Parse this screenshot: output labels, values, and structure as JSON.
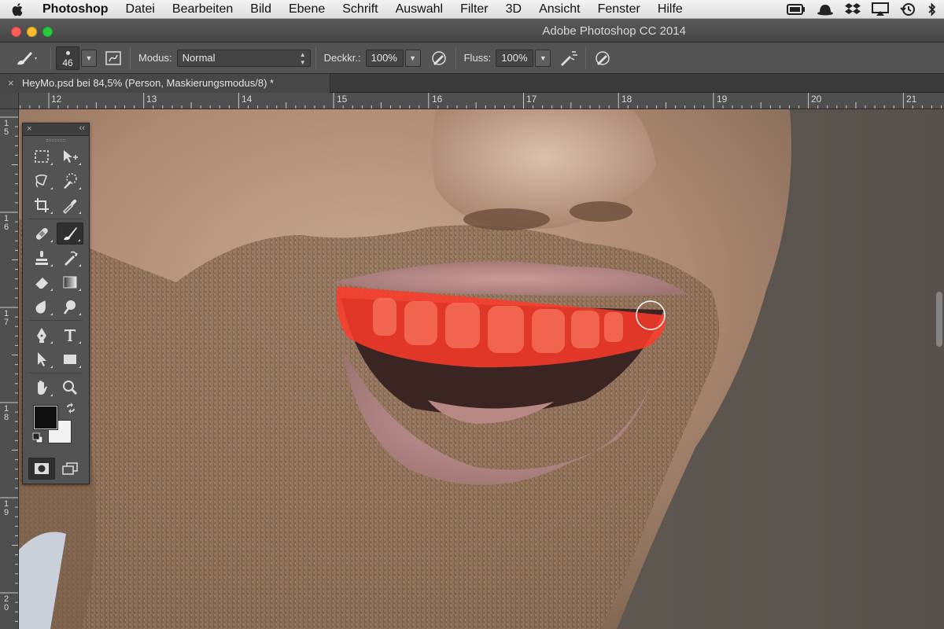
{
  "menubar": {
    "app_name": "Photoshop",
    "items": [
      "Datei",
      "Bearbeiten",
      "Bild",
      "Ebene",
      "Schrift",
      "Auswahl",
      "Filter",
      "3D",
      "Ansicht",
      "Fenster",
      "Hilfe"
    ]
  },
  "window": {
    "title": "Adobe Photoshop CC 2014"
  },
  "options": {
    "brush_size": "46",
    "mode_label": "Modus:",
    "mode_value": "Normal",
    "opacity_label": "Deckkr.:",
    "opacity_value": "100%",
    "flow_label": "Fluss:",
    "flow_value": "100%"
  },
  "document": {
    "tab_title": "HeyMo.psd bei 84,5% (Person, Maskierungsmodus/8) *",
    "tab_close": "×"
  },
  "rulers": {
    "horizontal": [
      "12",
      "13",
      "14",
      "15",
      "16",
      "17",
      "18",
      "19",
      "20",
      "21"
    ],
    "vertical": [
      "15",
      "16",
      "17",
      "18",
      "19",
      "20"
    ]
  },
  "tools": {
    "close": "×",
    "collapse": "‹‹",
    "foreground_color": "#101010",
    "background_color": "#f2f2f2"
  },
  "colors": {
    "quickmask_overlay": "#ff3b2a",
    "canvas_background": "#5c564f"
  }
}
